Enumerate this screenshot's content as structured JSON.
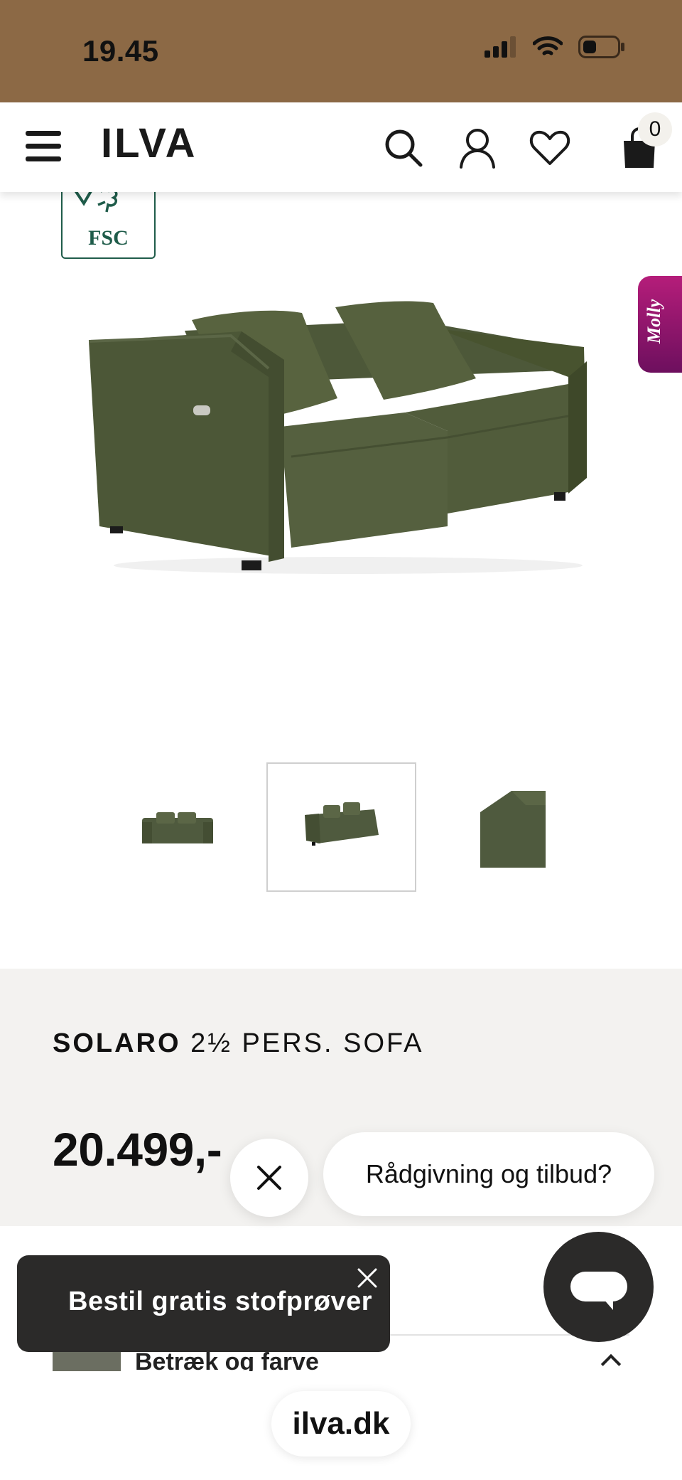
{
  "status_bar": {
    "time": "19.45",
    "icons": [
      "cellular-signal-icon",
      "wifi-icon",
      "battery-icon"
    ]
  },
  "header": {
    "logo": "ILVA",
    "icons": [
      "menu-icon",
      "search-icon",
      "account-icon",
      "heart-icon",
      "cart-icon"
    ],
    "cart_count": "0"
  },
  "badges": {
    "fsc_label": "FSC",
    "assistant_label": "Molly"
  },
  "gallery": {
    "thumbnail_count": 3,
    "active_index": 1
  },
  "product": {
    "brand": "SOLARO",
    "name": "2½ PERS. SOFA",
    "price": "20.499,-"
  },
  "chat": {
    "prompt": "Rådgivning og tilbud?",
    "icons": [
      "close-icon",
      "chat-icon"
    ]
  },
  "toast": {
    "text": "Bestil gratis stofprøver"
  },
  "options": {
    "cover_label": "Betræk og farve"
  },
  "browser": {
    "url": "ilva.dk"
  },
  "colors": {
    "status_bar": "#8c6945",
    "sofa_green": "#4f5a3e",
    "panel_bg": "#f3f2f0",
    "dark": "#2b2a29",
    "molly_magenta": "#a0176f",
    "fsc_green": "#1f5c4a"
  }
}
